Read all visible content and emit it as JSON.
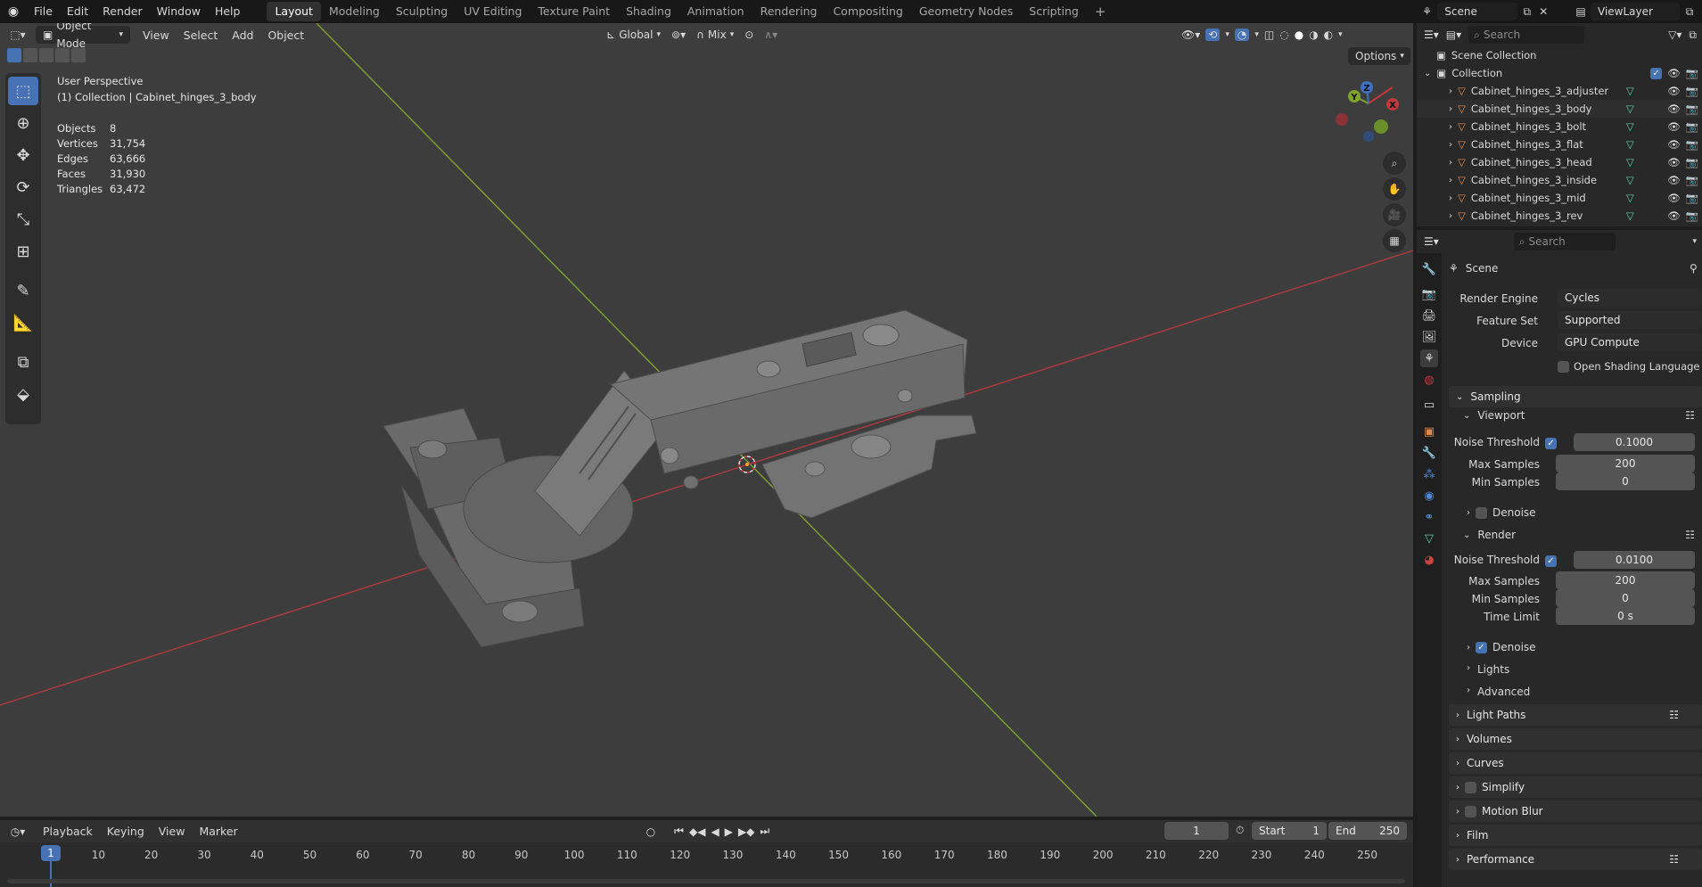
{
  "topbar": {
    "menus": [
      "File",
      "Edit",
      "Render",
      "Window",
      "Help"
    ],
    "workspaces": [
      "Layout",
      "Modeling",
      "Sculpting",
      "UV Editing",
      "Texture Paint",
      "Shading",
      "Animation",
      "Rendering",
      "Compositing",
      "Geometry Nodes",
      "Scripting"
    ],
    "active_workspace": "Layout",
    "add_workspace": "+",
    "scene_name": "Scene",
    "view_layer": "ViewLayer"
  },
  "viewport": {
    "mode": "Object Mode",
    "menus": [
      "View",
      "Select",
      "Add",
      "Object"
    ],
    "orientation": "Global",
    "snap_mode": "Mix",
    "options_label": "Options",
    "perspective_label": "User Perspective",
    "collection_label": "(1) Collection | Cabinet_hinges_3_body",
    "stats": [
      {
        "key": "Objects",
        "value": "8"
      },
      {
        "key": "Vertices",
        "value": "31,754"
      },
      {
        "key": "Edges",
        "value": "63,666"
      },
      {
        "key": "Faces",
        "value": "31,930"
      },
      {
        "key": "Triangles",
        "value": "63,472"
      }
    ],
    "gizmo": {
      "x": "X",
      "y": "Y",
      "z": "Z"
    }
  },
  "outliner": {
    "search_placeholder": "Search",
    "scene_collection": "Scene Collection",
    "collection": "Collection",
    "objects": [
      "Cabinet_hinges_3_adjuster",
      "Cabinet_hinges_3_body",
      "Cabinet_hinges_3_bolt",
      "Cabinet_hinges_3_flat",
      "Cabinet_hinges_3_head",
      "Cabinet_hinges_3_inside",
      "Cabinet_hinges_3_mid",
      "Cabinet_hinges_3_rev"
    ]
  },
  "properties": {
    "search_placeholder": "Search",
    "context": "Scene",
    "render_engine_label": "Render Engine",
    "render_engine": "Cycles",
    "feature_set_label": "Feature Set",
    "feature_set": "Supported",
    "device_label": "Device",
    "device": "GPU Compute",
    "osl_label": "Open Shading Language",
    "sampling": "Sampling",
    "viewport": "Viewport",
    "noise_threshold_label": "Noise Threshold",
    "viewport_noise_threshold": "0.1000",
    "max_samples_label": "Max Samples",
    "viewport_max_samples": "200",
    "min_samples_label": "Min Samples",
    "viewport_min_samples": "0",
    "denoise_label": "Denoise",
    "render": "Render",
    "render_noise_threshold": "0.0100",
    "render_max_samples": "200",
    "render_min_samples": "0",
    "time_limit_label": "Time Limit",
    "time_limit": "0 s",
    "lights": "Lights",
    "advanced": "Advanced",
    "light_paths": "Light Paths",
    "volumes": "Volumes",
    "curves": "Curves",
    "simplify": "Simplify",
    "motion_blur": "Motion Blur",
    "film": "Film",
    "performance": "Performance"
  },
  "timeline": {
    "menus": [
      "Playback",
      "Keying",
      "View",
      "Marker"
    ],
    "current_frame": "1",
    "start_label": "Start",
    "start": "1",
    "end_label": "End",
    "end": "250",
    "ticks": [
      "1",
      "10",
      "20",
      "30",
      "40",
      "50",
      "60",
      "70",
      "80",
      "90",
      "100",
      "110",
      "120",
      "130",
      "140",
      "150",
      "160",
      "170",
      "180",
      "190",
      "200",
      "210",
      "220",
      "230",
      "240",
      "250"
    ]
  },
  "colors": {
    "accent": "#4772b3",
    "x_axis": "#c0393b",
    "y_axis": "#7ea32f",
    "mesh_icon": "#e0894a",
    "data_icon": "#5fcfa0"
  }
}
